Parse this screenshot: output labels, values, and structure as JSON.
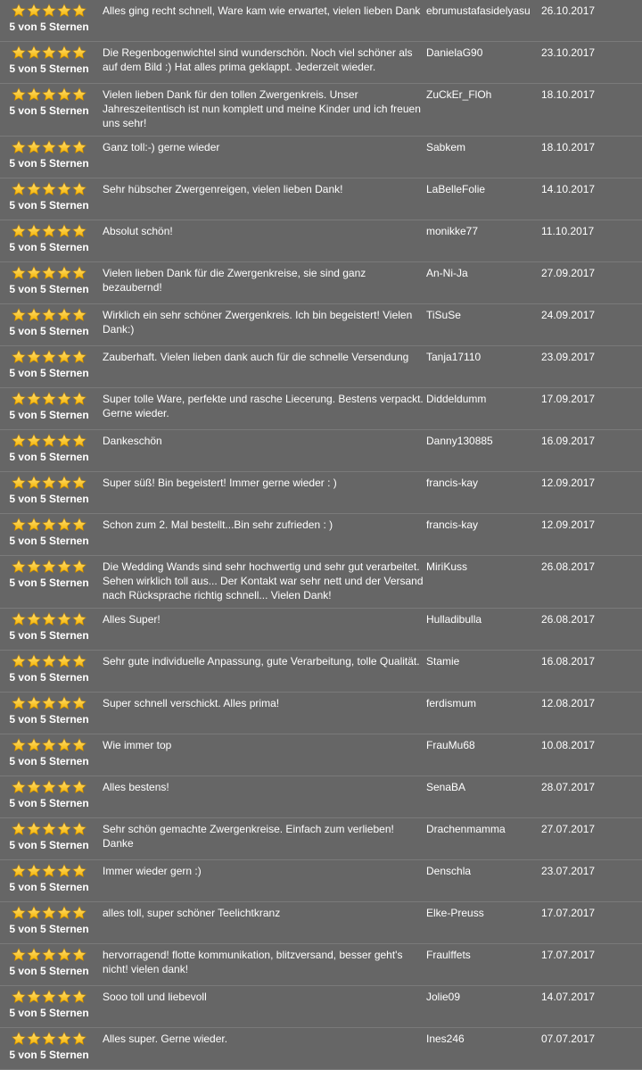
{
  "colors": {
    "background": "#666666",
    "divider": "#7a7a7a",
    "text": "#ffffff",
    "star": "#f5b301"
  },
  "icons": {
    "rating_star": "star-icon"
  },
  "reviews": [
    {
      "stars": 5,
      "rating_label": "5 von 5 Sternen",
      "comment": "Alles ging recht schnell, Ware kam wie erwartet, vielen lieben Dank",
      "author": "ebrumustafasidelyasu",
      "date": "26.10.2017"
    },
    {
      "stars": 5,
      "rating_label": "5 von 5 Sternen",
      "comment": "Die Regenbogenwichtel sind wunderschön. Noch viel schöner als auf dem Bild :) Hat alles prima geklappt. Jederzeit wieder.",
      "author": "DanielaG90",
      "date": "23.10.2017"
    },
    {
      "stars": 5,
      "rating_label": "5 von 5 Sternen",
      "comment": "Vielen lieben Dank für den tollen Zwergenkreis. Unser Jahreszeitentisch ist nun komplett und meine Kinder und ich freuen uns sehr!",
      "author": "ZuCkEr_FlOh",
      "date": "18.10.2017"
    },
    {
      "stars": 5,
      "rating_label": "5 von 5 Sternen",
      "comment": "Ganz toll:-) gerne wieder",
      "author": "Sabkem",
      "date": "18.10.2017"
    },
    {
      "stars": 5,
      "rating_label": "5 von 5 Sternen",
      "comment": "Sehr hübscher Zwergenreigen, vielen lieben Dank!",
      "author": "LaBelleFolie",
      "date": "14.10.2017"
    },
    {
      "stars": 5,
      "rating_label": "5 von 5 Sternen",
      "comment": "Absolut schön!",
      "author": "monikke77",
      "date": "11.10.2017"
    },
    {
      "stars": 5,
      "rating_label": "5 von 5 Sternen",
      "comment": "Vielen lieben Dank für die Zwergenkreise, sie sind ganz bezaubernd!",
      "author": "An-Ni-Ja",
      "date": "27.09.2017"
    },
    {
      "stars": 5,
      "rating_label": "5 von 5 Sternen",
      "comment": "Wirklich ein sehr schöner Zwergenkreis. Ich bin begeistert! Vielen Dank:)",
      "author": "TiSuSe",
      "date": "24.09.2017"
    },
    {
      "stars": 5,
      "rating_label": "5 von 5 Sternen",
      "comment": "Zauberhaft. Vielen lieben dank auch für die schnelle Versendung",
      "author": "Tanja17110",
      "date": "23.09.2017"
    },
    {
      "stars": 5,
      "rating_label": "5 von 5 Sternen",
      "comment": "Super tolle Ware, perfekte und rasche Liecerung. Bestens verpackt. Gerne wieder.",
      "author": "Diddeldumm",
      "date": "17.09.2017"
    },
    {
      "stars": 5,
      "rating_label": "5 von 5 Sternen",
      "comment": "Dankeschön",
      "author": "Danny130885",
      "date": "16.09.2017"
    },
    {
      "stars": 5,
      "rating_label": "5 von 5 Sternen",
      "comment": "Super süß! Bin begeistert! Immer gerne wieder : )",
      "author": "francis-kay",
      "date": "12.09.2017"
    },
    {
      "stars": 5,
      "rating_label": "5 von 5 Sternen",
      "comment": "Schon zum 2. Mal bestellt...Bin sehr zufrieden : )",
      "author": "francis-kay",
      "date": "12.09.2017"
    },
    {
      "stars": 5,
      "rating_label": "5 von 5 Sternen",
      "comment": "Die Wedding Wands sind sehr hochwertig und sehr gut verarbeitet. Sehen wirklich toll aus... Der Kontakt war sehr nett und der Versand nach Rücksprache richtig schnell... Vielen Dank!",
      "author": "MiriKuss",
      "date": "26.08.2017"
    },
    {
      "stars": 5,
      "rating_label": "5 von 5 Sternen",
      "comment": "Alles Super!",
      "author": "Hulladibulla",
      "date": "26.08.2017"
    },
    {
      "stars": 5,
      "rating_label": "5 von 5 Sternen",
      "comment": "Sehr gute individuelle Anpassung, gute Verarbeitung, tolle Qualität.",
      "author": "Stamie",
      "date": "16.08.2017"
    },
    {
      "stars": 5,
      "rating_label": "5 von 5 Sternen",
      "comment": "Super schnell verschickt. Alles prima!",
      "author": "ferdismum",
      "date": "12.08.2017"
    },
    {
      "stars": 5,
      "rating_label": "5 von 5 Sternen",
      "comment": "Wie immer top",
      "author": "FrauMu68",
      "date": "10.08.2017"
    },
    {
      "stars": 5,
      "rating_label": "5 von 5 Sternen",
      "comment": "Alles bestens!",
      "author": "SenaBA",
      "date": "28.07.2017"
    },
    {
      "stars": 5,
      "rating_label": "5 von 5 Sternen",
      "comment": "Sehr schön gemachte Zwergenkreise. Einfach zum verlieben! Danke",
      "author": "Drachenmamma",
      "date": "27.07.2017"
    },
    {
      "stars": 5,
      "rating_label": "5 von 5 Sternen",
      "comment": "Immer wieder gern :)",
      "author": "Denschla",
      "date": "23.07.2017"
    },
    {
      "stars": 5,
      "rating_label": "5 von 5 Sternen",
      "comment": "alles toll, super schöner Teelichtkranz",
      "author": "Elke-Preuss",
      "date": "17.07.2017"
    },
    {
      "stars": 5,
      "rating_label": "5 von 5 Sternen",
      "comment": "hervorragend! flotte kommunikation, blitzversand, besser geht's nicht! vielen dank!",
      "author": "Fraulffets",
      "date": "17.07.2017"
    },
    {
      "stars": 5,
      "rating_label": "5 von 5 Sternen",
      "comment": "Sooo toll und liebevoll",
      "author": "Jolie09",
      "date": "14.07.2017"
    },
    {
      "stars": 5,
      "rating_label": "5 von 5 Sternen",
      "comment": "Alles super. Gerne wieder.",
      "author": "Ines246",
      "date": "07.07.2017"
    }
  ]
}
